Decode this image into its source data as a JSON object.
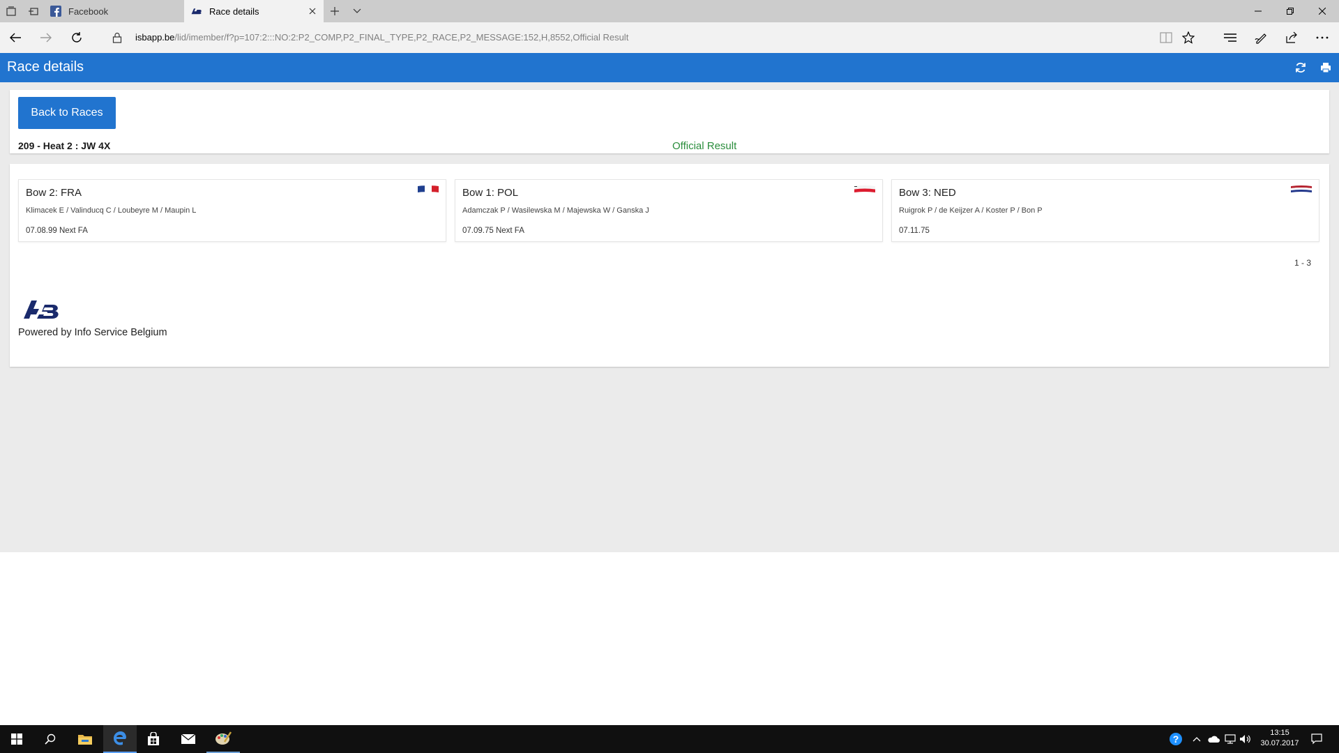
{
  "browser": {
    "tabs": [
      {
        "label": "Facebook",
        "active": false,
        "icon": "facebook-icon"
      },
      {
        "label": "Race details",
        "active": true,
        "icon": "isb-logo-icon"
      }
    ],
    "url_host": "isbapp.be",
    "url_path": "/lid/imember/f?p=107:2:::NO:2:P2_COMP,P2_FINAL_TYPE,P2_RACE,P2_MESSAGE:152,H,8552,Official Result"
  },
  "app": {
    "header_title": "Race details",
    "accent_color": "#2174cf"
  },
  "race": {
    "back_label": "Back to Races",
    "title": "209 - Heat 2 : JW 4X",
    "status": "Official Result",
    "status_color": "#2a8d3c"
  },
  "entries": [
    {
      "bow": "Bow 2: FRA",
      "crew": "Klimacek E / Valinducq C / Loubeyre M / Maupin L",
      "time": "07.08.99 Next FA",
      "flag": "france-flag-icon"
    },
    {
      "bow": "Bow 1: POL",
      "crew": "Adamczak P / Wasilewska M / Majewska W / Ganska J",
      "time": "07.09.75 Next FA",
      "flag": "poland-flag-icon"
    },
    {
      "bow": "Bow 3: NED",
      "crew": "Ruigrok P / de Keijzer A / Koster P / Bon P",
      "time": "07.11.75",
      "flag": "netherlands-flag-icon"
    }
  ],
  "pagination": {
    "range": "1 - 3"
  },
  "footer": {
    "powered_by": "Powered by Info Service Belgium"
  },
  "taskbar": {
    "time": "13:15",
    "date": "30.07.2017"
  }
}
